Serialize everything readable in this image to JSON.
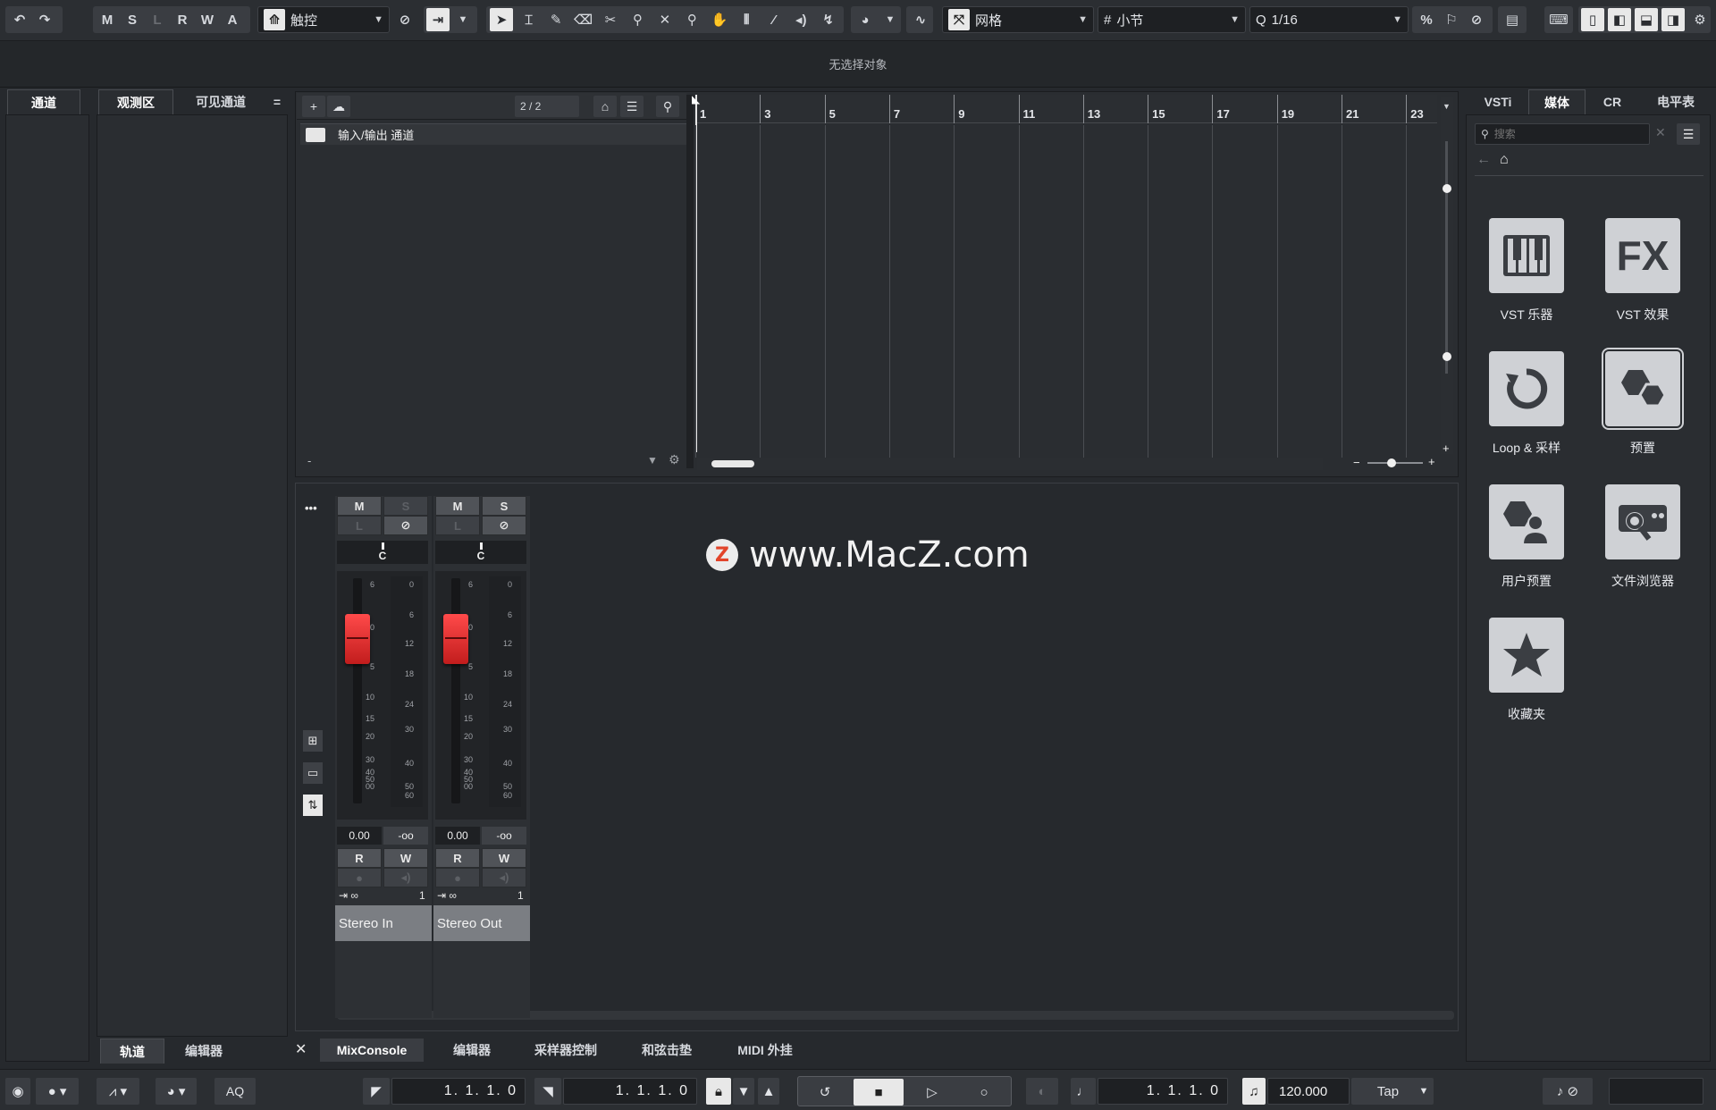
{
  "toolbar": {
    "undo": "↶",
    "redo": "↷",
    "state_buttons": [
      "M",
      "S",
      "L",
      "R",
      "W",
      "A"
    ],
    "automation_mode": "触控",
    "tool_icons": [
      "select-icon",
      "range-icon",
      "draw-icon",
      "erase-icon",
      "split-icon",
      "glue-icon",
      "mute-icon",
      "zoom-icon",
      "hand-icon",
      "timewarp-icon",
      "line-icon",
      "speaker-icon",
      "comp-icon"
    ],
    "snap_type": "网格",
    "grid_type": "小节",
    "quantize_value": "1/16"
  },
  "info_line": "无选择对象",
  "left_zone": {
    "tab_channel": "通道",
    "tab_inspector": "观测区",
    "tab_visibility": "可见通道",
    "menu_symbol": "=",
    "bottom_tab_tracks": "轨道",
    "bottom_tab_editor": "编辑器"
  },
  "project": {
    "track_count": "2 / 2",
    "folder_track_name": "输入/输出 通道",
    "minus_label": "-",
    "ruler_bars": [
      "1",
      "3",
      "5",
      "7",
      "9",
      "11",
      "13",
      "15",
      "17",
      "19",
      "21",
      "23"
    ]
  },
  "mixer": {
    "more_icon": "•••",
    "channels": [
      {
        "name": "Stereo In",
        "mute": "M",
        "solo": "S",
        "solo_active": false,
        "pan": "C",
        "volume": "0.00",
        "peak": "-oo",
        "read": "R",
        "write": "W",
        "routing_index": "1"
      },
      {
        "name": "Stereo Out",
        "mute": "M",
        "solo": "S",
        "solo_active": true,
        "pan": "C",
        "volume": "0.00",
        "peak": "-oo",
        "read": "R",
        "write": "W",
        "routing_index": "1"
      }
    ],
    "fader_scale": [
      "6",
      "0",
      "5",
      "10",
      "15",
      "20",
      "30",
      "40",
      "50",
      "00"
    ],
    "meter_scale": [
      "0",
      "6",
      "12",
      "18",
      "24",
      "30",
      "40",
      "50",
      "60"
    ]
  },
  "watermark": {
    "logo": "Z",
    "text": "www.MacZ.com"
  },
  "bottom_tabs": [
    "MixConsole",
    "编辑器",
    "采样器控制",
    "和弦击垫",
    "MIDI 外挂"
  ],
  "close_symbol": "✕",
  "right_zone": {
    "tabs": [
      "VSTi",
      "媒体",
      "CR",
      "电平表"
    ],
    "active_tab": "媒体",
    "search_placeholder": "搜索",
    "items": [
      {
        "label": "VST 乐器",
        "icon": "piano-keys-icon"
      },
      {
        "label": "VST 效果",
        "icon": "fx-icon"
      },
      {
        "label": "Loop & 采样",
        "icon": "loop-icon"
      },
      {
        "label": "预置",
        "icon": "preset-hexagon-icon",
        "selected": true
      },
      {
        "label": "用户预置",
        "icon": "user-preset-icon"
      },
      {
        "label": "文件浏览器",
        "icon": "file-browser-icon"
      },
      {
        "label": "收藏夹",
        "icon": "star-icon"
      }
    ]
  },
  "transport": {
    "left_locator": "1. 1. 1.   0",
    "right_locator": "1. 1. 1.   0",
    "primary_time": "1. 1. 1.   0",
    "tempo": "120.000",
    "tap_label": "Tap",
    "aq_label": "AQ"
  },
  "colors": {
    "background": "#26292d",
    "fader_red": "#e23333",
    "panel": "#2a2d31"
  }
}
